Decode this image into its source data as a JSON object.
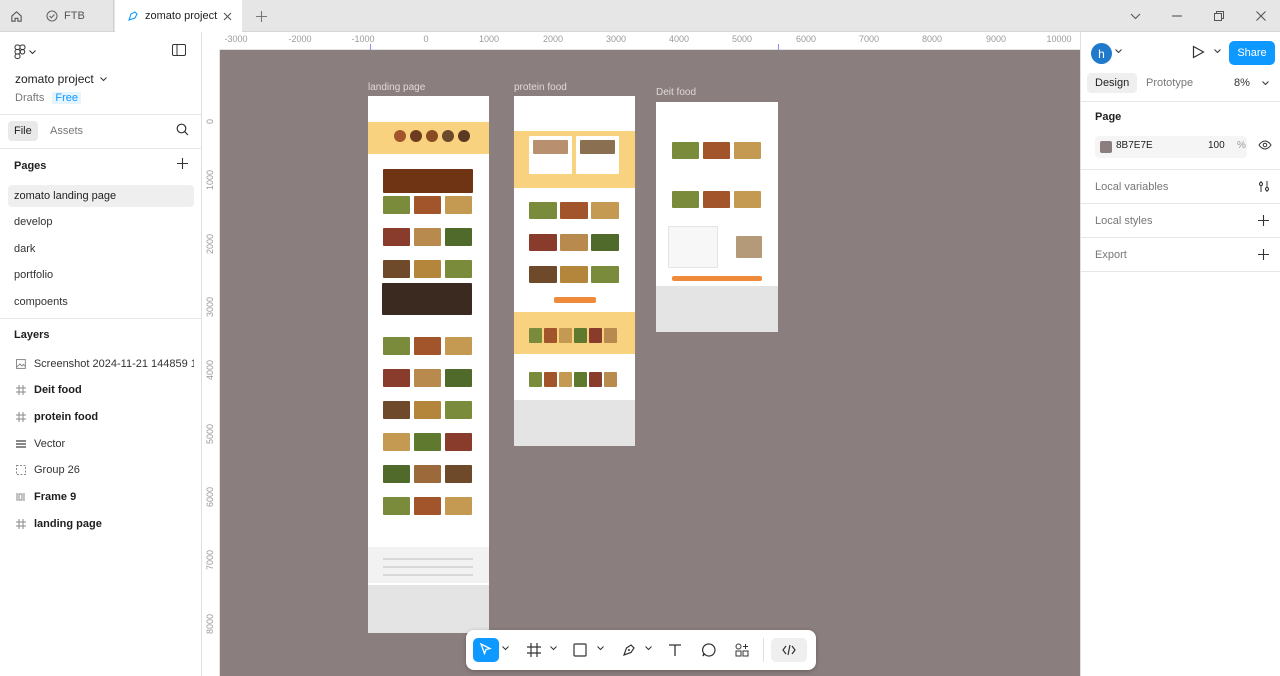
{
  "tabs": {
    "home_icon": "home-icon",
    "items": [
      {
        "label": "FTB",
        "icon": "grid-icon"
      },
      {
        "label": "zomato project",
        "icon": "figma-file-icon"
      }
    ],
    "new_tab_icon": "plus-icon"
  },
  "left_panel": {
    "project_name": "zomato project",
    "location": "Drafts",
    "plan_badge": "Free",
    "tabs": {
      "file": "File",
      "assets": "Assets"
    },
    "pages_heading": "Pages",
    "pages": [
      {
        "label": "zomato landing page",
        "active": true
      },
      {
        "label": "develop"
      },
      {
        "label": "dark"
      },
      {
        "label": "portfolio"
      },
      {
        "label": "compoents"
      }
    ],
    "layers_heading": "Layers",
    "layers": [
      {
        "label": "Screenshot 2024-11-21 144859 1",
        "icon": "image-icon"
      },
      {
        "label": "Deit food",
        "icon": "frame-icon"
      },
      {
        "label": "protein food",
        "icon": "frame-icon"
      },
      {
        "label": "Vector",
        "icon": "vector-icon"
      },
      {
        "label": "Group 26",
        "icon": "group-icon"
      },
      {
        "label": "Frame 9",
        "icon": "auto-layout-icon"
      },
      {
        "label": "landing page",
        "icon": "frame-icon"
      }
    ]
  },
  "canvas": {
    "background": "#8B7E7E",
    "ruler_x": [
      "-3000",
      "-2000",
      "-1000",
      "0",
      "1000",
      "2000",
      "3000",
      "4000",
      "5000",
      "6000",
      "7000",
      "8000",
      "9000",
      "10000"
    ],
    "ruler_y": [
      "0",
      "1000",
      "2000",
      "3000",
      "4000",
      "5000",
      "6000",
      "7000",
      "8000"
    ],
    "frames": {
      "landing": {
        "label": "landing page"
      },
      "protein": {
        "label": "protein food"
      },
      "diet": {
        "label": "Deit food"
      }
    }
  },
  "toolbar": {
    "tools": [
      "move-tool",
      "frame-tool",
      "rectangle-tool",
      "pen-tool",
      "text-tool",
      "comment-tool",
      "actions-tool",
      "dev-mode-toggle"
    ]
  },
  "right_panel": {
    "avatar_initial": "h",
    "share_label": "Share",
    "tabs": {
      "design": "Design",
      "prototype": "Prototype"
    },
    "zoom": "8%",
    "page_heading": "Page",
    "page_color": "8B7E7E",
    "page_color_hex": "#8B7E7E",
    "page_opacity": "100",
    "opacity_unit": "%",
    "local_variables": "Local variables",
    "local_styles": "Local styles",
    "export": "Export"
  },
  "help_label": "?"
}
